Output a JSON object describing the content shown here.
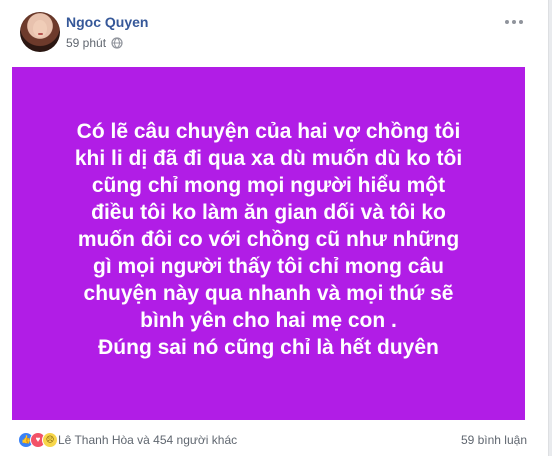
{
  "post": {
    "author": "Ngoc Quyen",
    "time": "59 phút",
    "privacy_icon": "globe-icon",
    "more_icon": "more-icon",
    "background_color": "#b11de6",
    "text_lines": [
      "Có lẽ câu chuyện của hai vợ chồng tôi",
      "khi li dị đã đi qua xa dù muốn dù ko tôi",
      "cũng chỉ mong mọi người hiểu một",
      "điều tôi ko làm ăn gian dối và tôi ko",
      "muốn đôi co với chồng cũ như những",
      "gì mọi người thấy tôi chỉ mong câu",
      "chuyện này qua nhanh và mọi thứ sẽ",
      "bình yên cho hai mẹ con .",
      "Đúng sai nó cũng chỉ là hết duyên"
    ]
  },
  "footer": {
    "reaction_icons": [
      "like-icon",
      "love-icon",
      "sad-icon"
    ],
    "reactors_text": "Lê Thanh Hòa và 454 người khác",
    "comments_text": "59 bình luận"
  }
}
